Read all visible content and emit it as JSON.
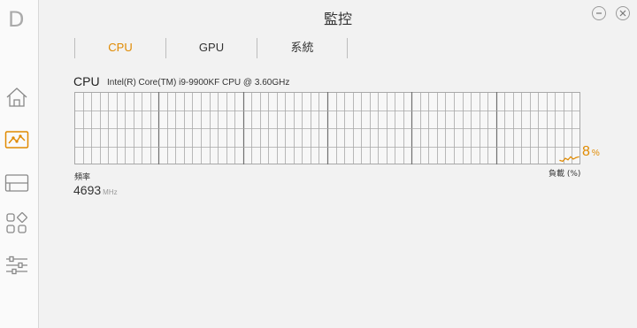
{
  "window": {
    "title": "監控",
    "logo_letter": "D"
  },
  "sidebar": {
    "items": [
      {
        "name": "home",
        "icon": "home-icon"
      },
      {
        "name": "monitor",
        "icon": "monitor-graph-icon",
        "active": true
      },
      {
        "name": "layout",
        "icon": "layout-icon"
      },
      {
        "name": "apps",
        "icon": "apps-grid-icon"
      },
      {
        "name": "settings",
        "icon": "sliders-icon"
      }
    ]
  },
  "tabs": [
    {
      "label": "CPU",
      "active": true
    },
    {
      "label": "GPU",
      "active": false
    },
    {
      "label": "系統",
      "active": false
    }
  ],
  "cpu": {
    "label": "CPU",
    "model": "Intel(R) Core(TM) i9-9900KF CPU @ 3.60GHz",
    "load_value": "8",
    "load_unit": "%",
    "load_label": "負載 (%)",
    "freq_label": "頻率",
    "freq_value": "4693",
    "freq_unit": "MHz"
  },
  "colors": {
    "accent": "#e08a00",
    "grid": "#a8a8a8",
    "grid_major": "#707070"
  },
  "chart_data": {
    "type": "line",
    "series": [
      {
        "values": [
          3,
          2,
          6,
          4,
          8,
          5,
          7,
          8
        ]
      }
    ],
    "ylim": [
      0,
      100
    ],
    "grid": true
  }
}
